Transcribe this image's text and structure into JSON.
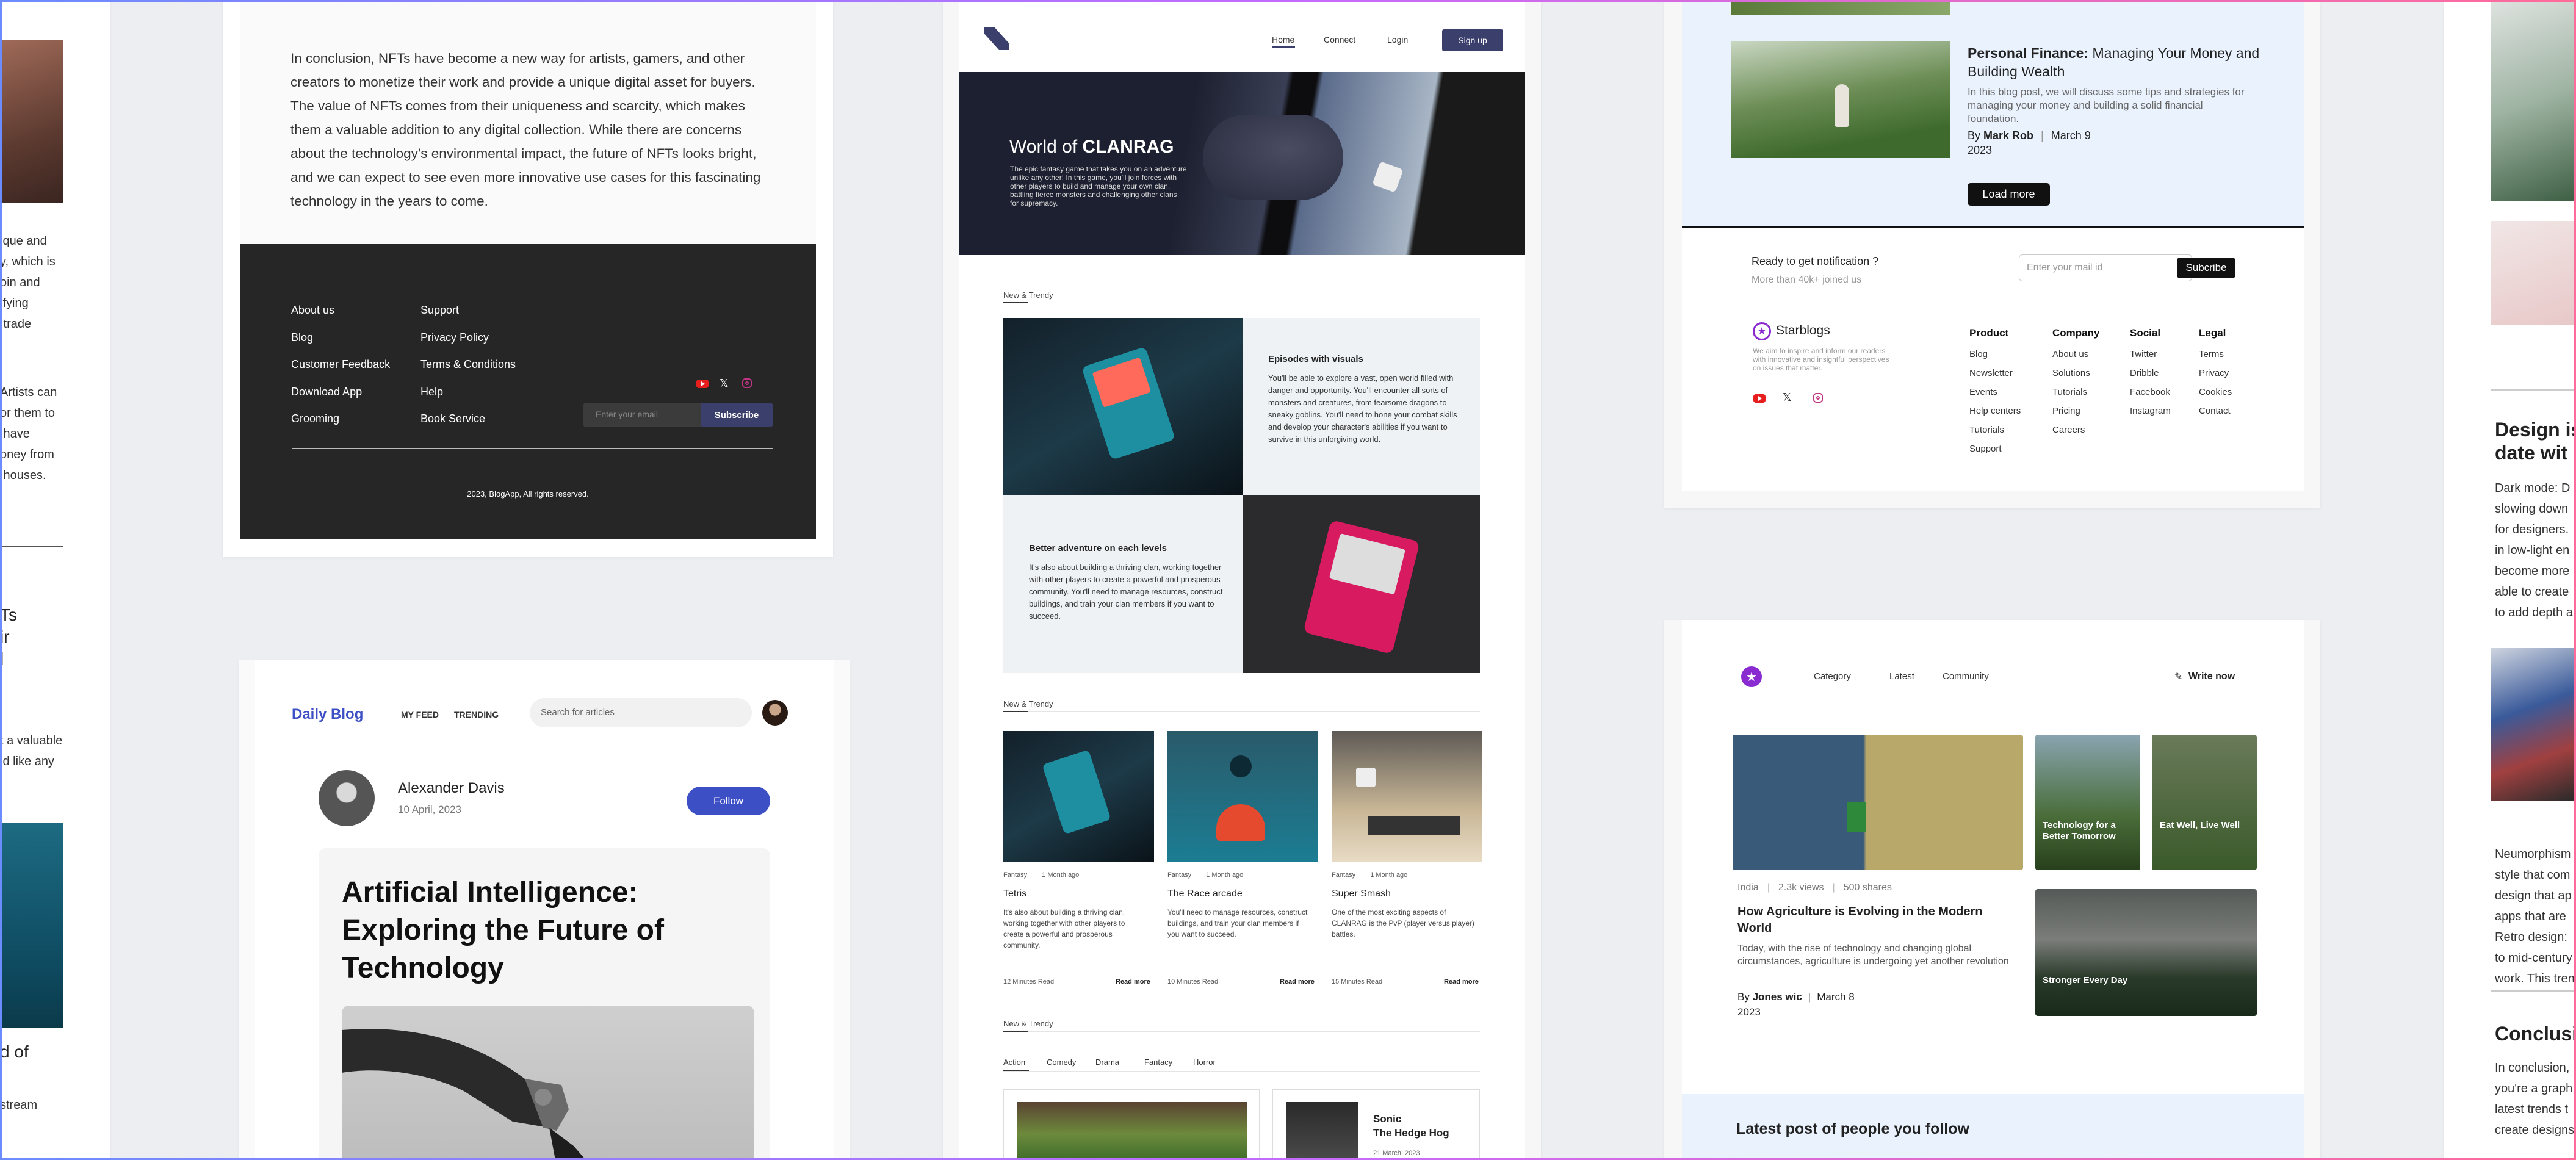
{
  "colors": {
    "bg": "#eceef2",
    "navy": "#3b3f6b",
    "blue": "#3d4fc4",
    "purple": "#8a2bd1",
    "lightblue": "#e9f2fd",
    "dark": "#262626",
    "red": "#e61e1e"
  },
  "col0": {
    "text1": "ique and\ny, which is\noin and\nifying\n trade",
    "text2": "Artists can\nor them to\n have\noney from\n houses.",
    "text3": "Ts\nir\nl",
    "text4": "t a valuable\nld like any",
    "text5": "d of",
    "text6": " stream"
  },
  "nft": {
    "paragraph": "In conclusion, NFTs have become a new way for artists, gamers, and other creators to monetize their work and provide a unique digital asset for buyers. The value of NFTs comes from their uniqueness and scarcity, which makes them a valuable addition to any digital collection. While there are concerns about the technology's environmental impact, the future of NFTs looks bright, and we can expect to see even more innovative use cases for this fascinating technology in the years to come.",
    "footer_col1": [
      "About us",
      "Blog",
      "Customer Feedback",
      "Download App",
      "Grooming"
    ],
    "footer_col2": [
      "Support",
      "Privacy Policy",
      "Terms & Conditions",
      "Help",
      "Book Service"
    ],
    "email_placeholder": "Enter your email",
    "subscribe": "Subscribe",
    "copyright": "2023, BlogApp, All rights reserved."
  },
  "daily": {
    "logo": "Daily Blog",
    "nav": [
      "MY FEED",
      "TRENDING"
    ],
    "search_placeholder": "Search for articles",
    "author": "Alexander Davis",
    "date": "10 April, 2023",
    "follow": "Follow",
    "title": "Artificial Intelligence: Exploring the Future of Technology"
  },
  "clanrag": {
    "nav": [
      "Home",
      "Connect",
      "Login"
    ],
    "signup": "Sign up",
    "hero_title_a": "World of ",
    "hero_title_b": "CLANRAG",
    "hero_desc": "The epic fantasy game that takes you on an adventure unlike any other! In this game, you'll join forces with other players to build and manage your own clan, battling fierce monsters and challenging other clans for supremacy.",
    "section1": "New & Trendy",
    "feat1_title": "Episodes with visuals",
    "feat1_desc": "You'll be able to explore a vast, open world filled with danger and opportunity. You'll encounter all sorts of monsters and creatures, from fearsome dragons to sneaky goblins. You'll need to hone your combat skills and develop your character's abilities if you want to survive in this unforgiving world.",
    "feat2_title": "Better adventure on each levels",
    "feat2_desc": "It's also about building a thriving clan, working together with other players to create a powerful and prosperous community. You'll need to manage resources, construct buildings, and train your clan members if you want to succeed.",
    "section2": "New & Trendy",
    "cards": [
      {
        "tag": "Fantasy",
        "ago": "1 Month ago",
        "title": "Tetris",
        "desc": "It's also about building a thriving clan, working together with other players to create a powerful and prosperous community.",
        "read": "12 Minutes Read",
        "more": "Read more"
      },
      {
        "tag": "Fantasy",
        "ago": "1 Month ago",
        "title": "The Race arcade",
        "desc": "You'll need to manage resources, construct buildings, and train your clan members if you want to succeed.",
        "read": "10 Minutes Read",
        "more": "Read more"
      },
      {
        "tag": "Fantasy",
        "ago": "1 Month ago",
        "title": "Super Smash",
        "desc": "One of the most exciting aspects of CLANRAG is the PvP (player versus player) battles.",
        "read": "15 Minutes Read",
        "more": "Read more"
      }
    ],
    "section3": "New & Trendy",
    "tabs": [
      "Action",
      "Comedy",
      "Drama",
      "Fantacy",
      "Horror"
    ],
    "sonic_title": "Sonic\nThe Hedge Hog",
    "sonic_date": "21 March, 2023"
  },
  "starblogs": {
    "post_title_bold": "Personal Finance:",
    "post_title_rest": " Managing Your Money and Building Wealth",
    "post_desc": "In this blog post, we will discuss some tips and strategies for managing your money and building a solid financial foundation.",
    "by": "By ",
    "author": "Mark Rob",
    "date": "March 9",
    "year": "2023",
    "load_more": "Load more",
    "notif_title": "Ready to get notification ?",
    "notif_sub": "More than 40k+ joined us",
    "mail_placeholder": "Enter your mail id",
    "subscribe": "Subcribe",
    "brand": "Starblogs",
    "brand_desc": "We aim to inspire and inform our readers with innovative and insightful perspectives on issues that matter.",
    "columns": [
      {
        "head": "Product",
        "items": [
          "Blog",
          "Newsletter",
          "Events",
          "Help centers",
          "Tutorials",
          "Support"
        ]
      },
      {
        "head": "Company",
        "items": [
          "About us",
          "Solutions",
          "Tutorials",
          "Pricing",
          "Careers"
        ]
      },
      {
        "head": "Social",
        "items": [
          "Twitter",
          "Dribble",
          "Facebook",
          "Instagram"
        ]
      },
      {
        "head": "Legal",
        "items": [
          "Terms",
          "Privacy",
          "Cookies",
          "Contact"
        ]
      }
    ]
  },
  "agri": {
    "nav": [
      "Category",
      "Latest",
      "Community"
    ],
    "write": "Write now",
    "meta": [
      "India",
      "2.3k views",
      "500 shares"
    ],
    "title": "How Agriculture is Evolving in the Modern World",
    "desc": " Today, with the rise of technology and changing global circumstances, agriculture is undergoing yet another revolution",
    "by": "By ",
    "author": "Jones wic",
    "date": "March 8",
    "year": "2023",
    "tile1": "Technology for a Better Tomorrow",
    "tile2": "Eat Well, Live Well",
    "tile3": "Stronger Every Day",
    "latest": "Latest post of people you follow"
  },
  "col6": {
    "heading": "Design is\ndate wit",
    "p1": "Dark mode: D\nslowing down\nfor designers.\nin low-light en\nbecome more\nable to create\nto add depth a",
    "p2": "Neumorphism\nstyle that com\ndesign that ap\napps that are\nRetro design:\nto mid-century\nwork. This tren",
    "heading2": "Conclusi",
    "p3": "In conclusion,\nyou're a graph\nlatest trends t\ncreate designs"
  }
}
